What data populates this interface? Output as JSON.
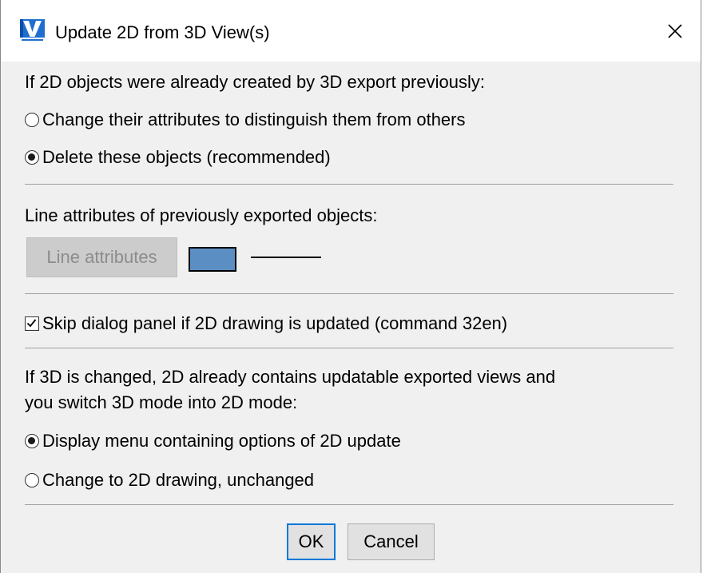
{
  "window": {
    "title": "Update 2D from 3D View(s)",
    "icon": "vectorcad-app-icon",
    "close_glyph": "✕"
  },
  "section1": {
    "heading": "If 2D objects were already created by 3D export previously:",
    "options": [
      {
        "label": "Change their attributes to distinguish them from others",
        "checked": false
      },
      {
        "label": "Delete these objects (recommended)",
        "checked": true
      }
    ]
  },
  "section2": {
    "heading": "Line attributes of previously exported objects:",
    "button_label": "Line attributes",
    "swatch_color": "#5b8fc4",
    "line_color": "#000000"
  },
  "section3": {
    "checkbox_label": "Skip dialog panel if 2D drawing is updated (command 32en)",
    "checked": true
  },
  "section4": {
    "heading_line1": "If 3D is changed, 2D already contains updatable exported views and",
    "heading_line2": "you switch 3D mode into 2D mode:",
    "options": [
      {
        "label": "Display menu containing options of 2D update",
        "checked": true
      },
      {
        "label": "Change to 2D drawing, unchanged",
        "checked": false
      }
    ]
  },
  "footer": {
    "ok_label": "OK",
    "cancel_label": "Cancel"
  },
  "colors": {
    "accent": "#0078d7",
    "dialog_bg": "#f0f0f0"
  }
}
